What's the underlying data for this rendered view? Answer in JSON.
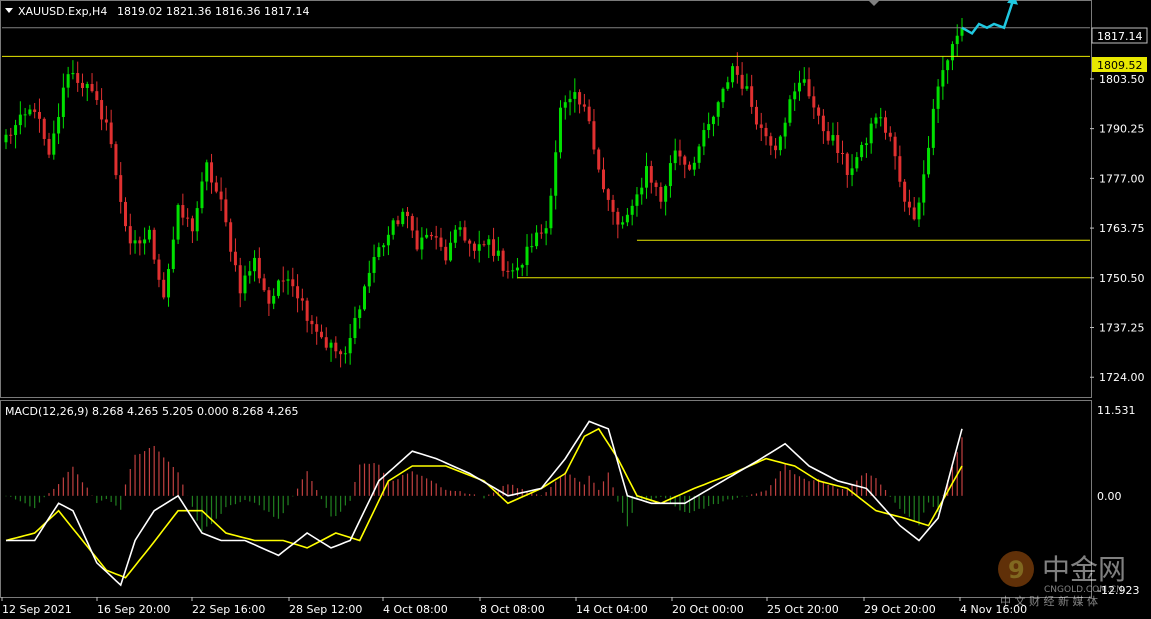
{
  "header": {
    "symbol": "XAUUSD.Exp,H4",
    "ohlc": "1819.02 1821.36 1816.36 1817.14"
  },
  "macd": {
    "label": "MACD(12,26,9) 8.268 4.265 5.205 0.000 8.268 4.265"
  },
  "price_labels": {
    "current": "1817.14",
    "resistance": "1809.52"
  },
  "watermark": {
    "brand_cn": "中金网",
    "brand_en": "CNGOLD.COM.CN",
    "tagline_cn": "中 文 财 经 新 媒 体"
  },
  "colors": {
    "background": "#000000",
    "bull_candle": "#00e000",
    "bear_candle": "#e03030",
    "level_line": "#e8e800",
    "current_price_line": "#808080",
    "macd_line": "#ffffff",
    "signal_line": "#ffff00",
    "hist_pos": "#c04040",
    "hist_neg": "#208020",
    "projection": "#20c8e0",
    "label_bg": "#e8e800"
  },
  "chart_data": [
    {
      "type": "candlestick",
      "symbol": "XAUUSD.Exp",
      "timeframe": "H4",
      "y_ticks": [
        1724.0,
        1737.25,
        1750.5,
        1763.75,
        1777.0,
        1790.25,
        1803.5
      ],
      "y_tick_labels": [
        "1724.00",
        "1737.25",
        "1750.50",
        "1763.75",
        "1777.00",
        "1790.25",
        "1803.50"
      ],
      "ylim": [
        1719,
        1824
      ],
      "x_tick_labels": [
        "12 Sep 2021",
        "16 Sep 20:00",
        "22 Sep 16:00",
        "28 Sep 12:00",
        "4 Oct 08:00",
        "8 Oct 08:00",
        "14 Oct 04:00",
        "20 Oct 00:00",
        "25 Oct 20:00",
        "29 Oct 20:00",
        "4 Nov 16:00"
      ],
      "current_price": 1817.14,
      "horizontal_levels": [
        1809.52,
        1760.5,
        1750.5
      ],
      "anchors": [
        [
          0,
          1788
        ],
        [
          3,
          1792
        ],
        [
          6,
          1796
        ],
        [
          9,
          1782
        ],
        [
          13,
          1806
        ],
        [
          17,
          1801
        ],
        [
          21,
          1792
        ],
        [
          26,
          1758
        ],
        [
          30,
          1762
        ],
        [
          33,
          1746
        ],
        [
          36,
          1768
        ],
        [
          39,
          1764
        ],
        [
          42,
          1780
        ],
        [
          45,
          1770
        ],
        [
          49,
          1748
        ],
        [
          52,
          1755
        ],
        [
          55,
          1744
        ],
        [
          59,
          1752
        ],
        [
          63,
          1741
        ],
        [
          67,
          1733
        ],
        [
          71,
          1729
        ],
        [
          74,
          1744
        ],
        [
          77,
          1756
        ],
        [
          80,
          1762
        ],
        [
          83,
          1768
        ],
        [
          86,
          1760
        ],
        [
          89,
          1762
        ],
        [
          92,
          1756
        ],
        [
          95,
          1764
        ],
        [
          98,
          1757
        ],
        [
          101,
          1760
        ],
        [
          104,
          1754
        ],
        [
          107,
          1752
        ],
        [
          110,
          1760
        ],
        [
          113,
          1764
        ],
        [
          116,
          1795
        ],
        [
          119,
          1798
        ],
        [
          122,
          1793
        ],
        [
          125,
          1774
        ],
        [
          128,
          1764
        ],
        [
          131,
          1768
        ],
        [
          134,
          1780
        ],
        [
          137,
          1771
        ],
        [
          140,
          1785
        ],
        [
          143,
          1780
        ],
        [
          146,
          1788
        ],
        [
          149,
          1796
        ],
        [
          152,
          1807
        ],
        [
          155,
          1800
        ],
        [
          158,
          1790
        ],
        [
          161,
          1786
        ],
        [
          164,
          1797
        ],
        [
          167,
          1804
        ],
        [
          170,
          1792
        ],
        [
          173,
          1787
        ],
        [
          176,
          1779
        ],
        [
          179,
          1784
        ],
        [
          182,
          1794
        ],
        [
          185,
          1788
        ],
        [
          188,
          1770
        ],
        [
          190,
          1767
        ],
        [
          192,
          1777
        ],
        [
          194,
          1797
        ],
        [
          196,
          1806
        ],
        [
          198,
          1812
        ],
        [
          200,
          1817
        ]
      ]
    },
    {
      "type": "line",
      "indicator": "MACD(12,26,9)",
      "y_tick_labels": [
        "11.531",
        "0.00",
        "-12.923"
      ],
      "series": [
        {
          "name": "MACD",
          "x": [
            0,
            6,
            11,
            14,
            19,
            24,
            27,
            31,
            36,
            41,
            45,
            50,
            57,
            63,
            68,
            72,
            78,
            85,
            90,
            97,
            105,
            112,
            117,
            122,
            126,
            130,
            135,
            142,
            150,
            158,
            163,
            168,
            174,
            180,
            187,
            191,
            195,
            200
          ],
          "values": [
            -6,
            -6,
            -1,
            -2,
            -9,
            -12,
            -6,
            -2,
            0,
            -5,
            -6,
            -6,
            -8,
            -5,
            -7,
            -6,
            2,
            6,
            5,
            3,
            0,
            1,
            5,
            10,
            9,
            0,
            -1,
            -1,
            2,
            5,
            7,
            4,
            2,
            1,
            -4,
            -6,
            -3,
            9
          ]
        },
        {
          "name": "Signal",
          "x": [
            0,
            6,
            11,
            16,
            21,
            25,
            30,
            36,
            41,
            46,
            52,
            58,
            63,
            69,
            74,
            80,
            85,
            92,
            100,
            105,
            112,
            117,
            121,
            124,
            128,
            132,
            137,
            144,
            152,
            159,
            165,
            170,
            176,
            182,
            188,
            193,
            200
          ],
          "values": [
            -6,
            -5,
            -2,
            -6,
            -10,
            -11,
            -7,
            -2,
            -2,
            -5,
            -6,
            -6,
            -7,
            -5,
            -6,
            2,
            4,
            4,
            2,
            -1,
            1,
            3,
            8,
            9,
            5,
            0,
            -1,
            1,
            3,
            5,
            4,
            2,
            1,
            -2,
            -3,
            -4,
            4
          ]
        }
      ]
    }
  ]
}
